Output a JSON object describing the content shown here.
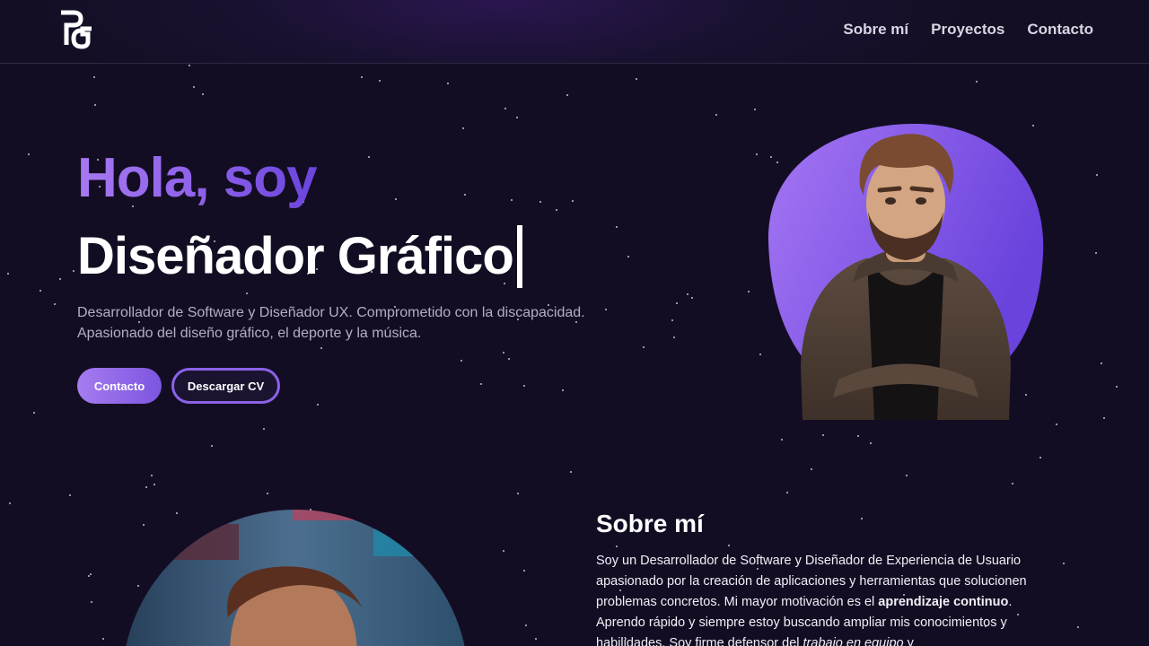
{
  "header": {
    "logo_text": "PG",
    "nav": [
      {
        "label": "Sobre mí"
      },
      {
        "label": "Proyectos"
      },
      {
        "label": "Contacto"
      }
    ]
  },
  "hero": {
    "greeting": "Hola, soy",
    "role": "Diseñador Gráfico",
    "description_line1": "Desarrollador de Software y Diseñador UX. Comprometido con la discapacidad.",
    "description_line2": "Apasionado del diseño gráfico, el deporte y la música.",
    "button_contact": "Contacto",
    "button_cv": "Descargar CV"
  },
  "about": {
    "title": "Sobre mí",
    "p1": "Soy un Desarrollador de Software y Diseñador de Experiencia de Usuario apasionado por la creación de aplicaciones y herramientas que solucionen problemas concretos. Mi mayor motivación es el ",
    "p1_bold": "aprendizaje continuo",
    "p2": ". Aprendo rápido y siempre estoy buscando ampliar mis conocimientos y habilidades. Soy firme defensor del ",
    "p2_italic": "trabajo en equipo",
    "p3": " y"
  },
  "colors": {
    "background": "#130d23",
    "accent_start": "#a779f2",
    "accent_end": "#6a45dc",
    "text_muted": "#b3afc0"
  },
  "icons": {
    "logo": "pg-monogram-logo",
    "avatar": "3d-avatar-illustration",
    "photo": "portrait-photo"
  }
}
